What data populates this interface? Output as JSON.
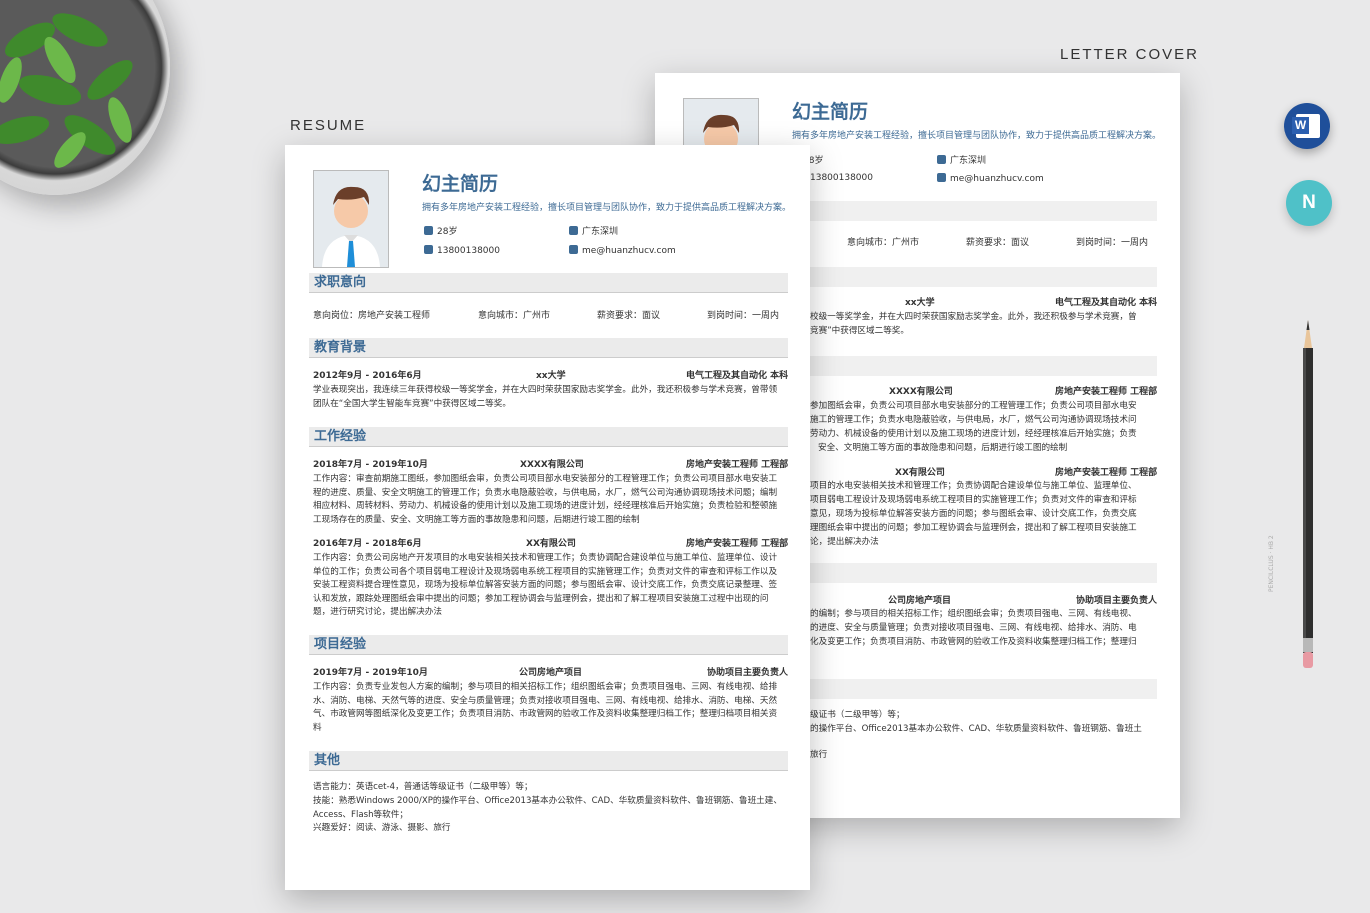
{
  "labels": {
    "letter_cover": "LETTER COVER",
    "resume": "RESUME"
  },
  "front": {
    "name": "幻主简历",
    "subtitle": "拥有多年房地产安装工程经验，擅长项目管理与团队协作，致力于提供高品质工程解决方案。",
    "info": {
      "age": "28岁",
      "city": "广东深圳",
      "phone": "13800138000",
      "email": "me@huanzhucv.com"
    },
    "sections": {
      "intent": "求职意向",
      "edu": "教育背景",
      "work": "工作经验",
      "project": "项目经验",
      "other": "其他"
    },
    "intent": {
      "position": "意向岗位：房地产安装工程师",
      "city": "意向城市：广州市",
      "salary": "薪资要求：面议",
      "arrival": "到岗时间：一周内"
    },
    "edu": {
      "date": "2012年9月 - 2016年6月",
      "school": "xx大学",
      "major": "电气工程及其自动化 本科",
      "desc": "学业表现突出，我连续三年获得校级一等奖学金，并在大四时荣获国家励志奖学金。此外，我还积极参与学术竞赛，曾带领团队在“全国大学生智能车竞赛”中获得区域二等奖。"
    },
    "work": [
      {
        "date": "2018年7月 - 2019年10月",
        "company": "XXXX有限公司",
        "title": "房地产安装工程师 工程部",
        "desc": "工作内容：审查前期施工图纸，参加图纸会审，负责公司项目部水电安装部分的工程管理工作；负责公司项目部水电安装工程的进度、质量、安全文明施工的管理工作；负责水电隐蔽验收，与供电局，水厂，燃气公司沟通协调现场技术问题；编制相应材料、周转材料、劳动力、机械设备的使用计划以及施工现场的进度计划，经经理核准后开始实施；负责检验和整顿施工现场存在的质量、安全、文明施工等方面的事故隐患和问题，后期进行竣工图的绘制"
      },
      {
        "date": "2016年7月 - 2018年6月",
        "company": "XX有限公司",
        "title": "房地产安装工程师 工程部",
        "desc": "工作内容：负责公司房地产开发项目的水电安装相关技术和管理工作；负责协调配合建设单位与施工单位、监理单位、设计单位的工作；负责公司各个项目弱电工程设计及现场弱电系统工程项目的实施管理工作；负责对文件的审查和评标工作以及安装工程资料提合理性意见，现场为投标单位解答安装方面的问题；参与图纸会审、设计交底工作，负责交底记录整理、签认和发放，跟踪处理图纸会审中提出的问题；参加工程协调会与监理例会，提出和了解工程项目安装施工过程中出现的问题，进行研究讨论，提出解决办法"
      }
    ],
    "project": {
      "date": "2019年7月 - 2019年10月",
      "name": "公司房地产项目",
      "role": "协助项目主要负责人",
      "desc": "工作内容：负责专业发包人方案的编制；参与项目的相关招标工作；组织图纸会审；负责项目强电、三网、有线电视、给排水、消防、电梯、天然气等的进度、安全与质量管理；负责对接收项目强电、三网、有线电视、给排水、消防、电梯、天然气、市政管网等图纸深化及变更工作；负责项目消防、市政管网的验收工作及资料收集整理归档工作；整理归档项目相关资料"
    },
    "other": {
      "lang": "语言能力：英语cet-4，普通话等级证书（二级甲等）等；",
      "skill": "技能：熟悉Windows 2000/XP的操作平台、Office2013基本办公软件、CAD、华软质量资料软件、鲁班钢筋、鲁班土建、Access、Flash等软件；",
      "hobby": "兴趣爱好：阅读、游泳、摄影、旅行"
    }
  },
  "back": {
    "name": "幻主简历",
    "subtitle": "拥有多年房地产安装工程经验，擅长项目管理与团队协作，致力于提供高品质工程解决方案。",
    "age": "28岁",
    "city": "广东深圳",
    "phone": "13800138000",
    "email": "me@huanzhucv.com",
    "intent_city": "意向城市：广州市",
    "intent_salary": "薪资要求：面议",
    "intent_arrival": "到岗时间：一周内",
    "school": "xx大学",
    "major": "电气工程及其自动化 本科",
    "edu_l1": "校级一等奖学金，并在大四时荣获国家励志奖学金。此外，我还积极参与学术竞赛，曾",
    "edu_l2": "竞赛”中获得区域二等奖。",
    "w1_company": "XXXX有限公司",
    "w1_title": "房地产安装工程师 工程部",
    "w1_l1": "参加图纸会审，负责公司项目部水电安装部分的工程管理工作；负责公司项目部水电安",
    "w1_l2": "施工的管理工作；负责水电隐蔽验收，与供电局，水厂，燃气公司沟通协调现场技术问",
    "w1_l3": "劳动力、机械设备的使用计划以及施工现场的进度计划，经经理核准后开始实施；负责",
    "w1_l4": "安全、文明施工等方面的事故隐患和问题，后期进行竣工图的绘制",
    "w2_company": "XX有限公司",
    "w2_title": "房地产安装工程师 工程部",
    "w2_l1": "项目的水电安装相关技术和管理工作；负责协调配合建设单位与施工单位、监理单位、",
    "w2_l2": "项目弱电工程设计及现场弱电系统工程项目的实施管理工作；负责对文件的审查和评标",
    "w2_l3": "意见，现场为投标单位解答安装方面的问题；参与图纸会审、设计交底工作，负责交底",
    "w2_l4": "理图纸会审中提出的问题；参加工程协调会与监理例会，提出和了解工程项目安装施工",
    "w2_l5": "论，提出解决办法",
    "p_name": "公司房地产项目",
    "p_role": "协助项目主要负责人",
    "p_l1": "的编制；参与项目的相关招标工作；组织图纸会审；负责项目强电、三网、有线电视、",
    "p_l2": "的进度、安全与质量管理；负责对接收项目强电、三网、有线电视、给排水、消防、电",
    "p_l3": "化及变更工作；负责项目消防、市政管网的验收工作及资料收集整理归档工作；整理归",
    "o_l1": "级证书（二级甲等）等；",
    "o_l2": "的操作平台、Office2013基本办公软件、CAD、华软质量资料软件、鲁班钢筋、鲁班土",
    "o_l3": "旅行"
  },
  "icons": {
    "word": "W",
    "other": "N"
  },
  "pencil_text": "PENCILCLUS · HB 2"
}
